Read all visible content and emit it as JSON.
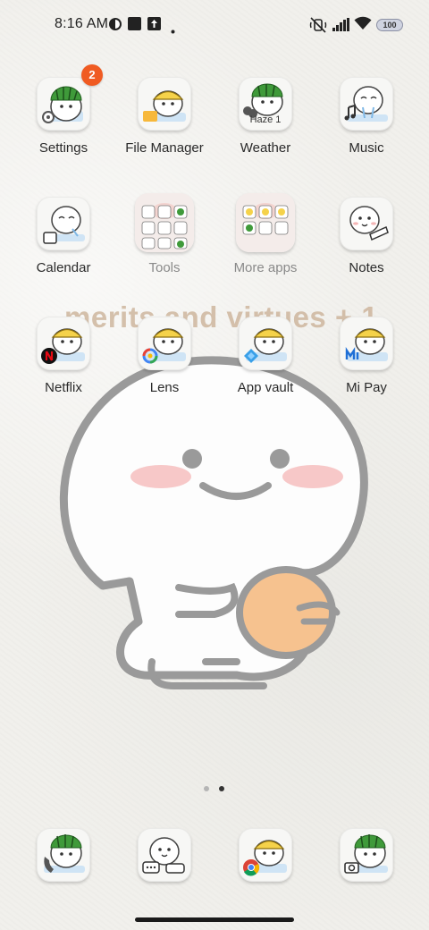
{
  "status_bar": {
    "time": "8:16 AM",
    "battery": "100",
    "icons": [
      "theme-icon",
      "square-icon",
      "upload-icon",
      "dot-icon",
      "mute-icon",
      "signal-icon",
      "wifi-icon",
      "battery-icon"
    ]
  },
  "wallpaper": {
    "text": "merits and virtues + 1"
  },
  "apps": [
    {
      "label": "Settings",
      "badge": "2",
      "icon": "settings-icon"
    },
    {
      "label": "File Manager",
      "icon": "file-manager-icon"
    },
    {
      "label": "Weather",
      "overlay": "Haze 1",
      "icon": "weather-icon"
    },
    {
      "label": "Music",
      "icon": "music-icon"
    },
    {
      "label": "Calendar",
      "icon": "calendar-icon"
    },
    {
      "label": "Tools",
      "icon": "tools-folder-icon"
    },
    {
      "label": "More apps",
      "icon": "more-apps-folder-icon"
    },
    {
      "label": "Notes",
      "icon": "notes-icon"
    },
    {
      "label": "Netflix",
      "icon": "netflix-icon"
    },
    {
      "label": "Lens",
      "icon": "lens-icon"
    },
    {
      "label": "App vault",
      "icon": "app-vault-icon"
    },
    {
      "label": "Mi Pay",
      "icon": "mi-pay-icon"
    }
  ],
  "dock": [
    {
      "icon": "phone-icon"
    },
    {
      "icon": "messages-icon"
    },
    {
      "icon": "chrome-icon"
    },
    {
      "icon": "camera-icon"
    }
  ],
  "page_indicator": {
    "pages": 2,
    "current": 2
  },
  "colors": {
    "badge": "#f05b22",
    "watermelon_green": "#3f9a3a",
    "hat_yellow": "#f5d24a",
    "blush": "#f4b6b6"
  }
}
